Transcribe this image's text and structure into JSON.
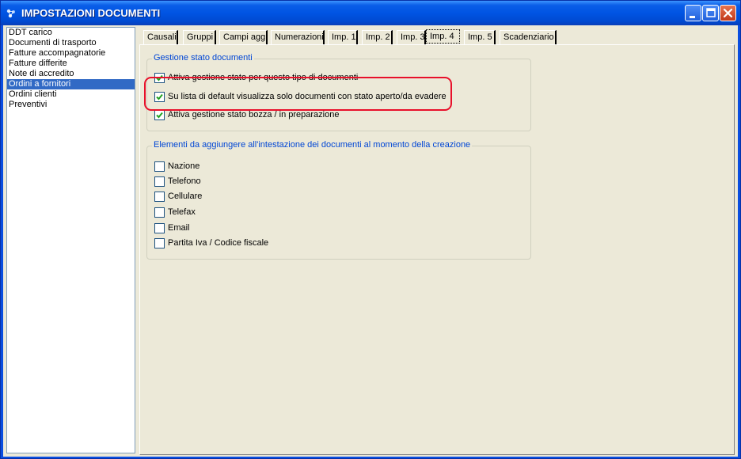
{
  "window": {
    "title": "IMPOSTAZIONI DOCUMENTI"
  },
  "doc_types": [
    {
      "label": "DDT carico",
      "selected": false
    },
    {
      "label": "Documenti di trasporto",
      "selected": false
    },
    {
      "label": "Fatture accompagnatorie",
      "selected": false
    },
    {
      "label": "Fatture differite",
      "selected": false
    },
    {
      "label": "Note di accredito",
      "selected": false
    },
    {
      "label": "Ordini a fornitori",
      "selected": true
    },
    {
      "label": "Ordini clienti",
      "selected": false
    },
    {
      "label": "Preventivi",
      "selected": false
    }
  ],
  "tabs": [
    {
      "label": "Causali"
    },
    {
      "label": "Gruppi"
    },
    {
      "label": "Campi agg."
    },
    {
      "label": "Numerazioni"
    },
    {
      "label": "Imp. 1"
    },
    {
      "label": "Imp. 2"
    },
    {
      "label": "Imp. 3"
    },
    {
      "label": "Imp. 4",
      "active": true
    },
    {
      "label": "Imp. 5"
    },
    {
      "label": "Scadenziario"
    }
  ],
  "stato_group": {
    "title": "Gestione stato documenti",
    "options": [
      {
        "label": "Attiva gestione stato per questo tipo di documenti",
        "checked": true
      },
      {
        "label": "Su lista di default visualizza solo documenti con stato aperto/da evadere",
        "checked": true
      },
      {
        "label": "Attiva gestione stato bozza / in preparazione",
        "checked": true
      }
    ]
  },
  "intestazione_group": {
    "title": "Elementi da aggiungere all'intestazione dei documenti al momento della creazione",
    "options": [
      {
        "label": "Nazione",
        "checked": false
      },
      {
        "label": "Telefono",
        "checked": false
      },
      {
        "label": "Cellulare",
        "checked": false
      },
      {
        "label": "Telefax",
        "checked": false
      },
      {
        "label": "Email",
        "checked": false
      },
      {
        "label": "Partita Iva / Codice fiscale",
        "checked": false
      }
    ]
  },
  "colors": {
    "title_bar": "#0054e3",
    "selection": "#316ac5",
    "group_title": "#0046d5",
    "highlight": "#e8102a",
    "check": "#21a121"
  }
}
